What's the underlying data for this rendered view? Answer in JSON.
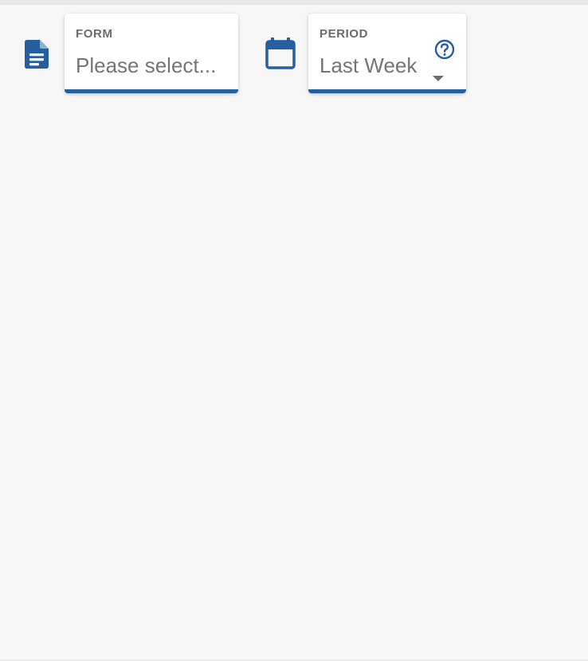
{
  "filters": {
    "form": {
      "label": "FORM",
      "value": "Please select...",
      "icon": "document-icon"
    },
    "period": {
      "label": "PERIOD",
      "value": "Last Week",
      "icon": "calendar-icon",
      "help_icon": "help-circle-icon",
      "caret_icon": "dropdown-caret-icon"
    }
  },
  "colors": {
    "accent": "#255f9f",
    "label": "#6c6c6c",
    "value": "#757575",
    "background": "#f7f7f7",
    "card": "#ffffff"
  }
}
